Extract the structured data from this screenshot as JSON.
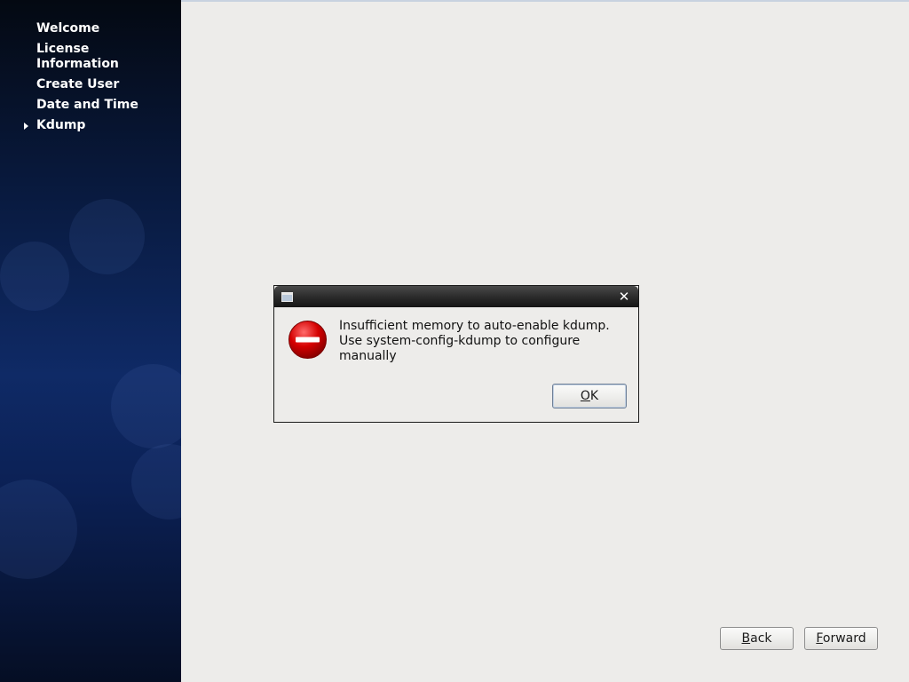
{
  "sidebar": {
    "items": [
      {
        "label": "Welcome",
        "current": false
      },
      {
        "label": "License Information",
        "current": false
      },
      {
        "label": "Create User",
        "current": false
      },
      {
        "label": "Date and Time",
        "current": false
      },
      {
        "label": "Kdump",
        "current": true
      }
    ]
  },
  "dialog": {
    "title": "",
    "message_line1": "Insufficient memory to auto-enable kdump.",
    "message_line2": "Use system-config-kdump to configure manually",
    "ok_mnemonic": "O",
    "ok_rest": "K",
    "icon": "error-icon"
  },
  "footer": {
    "back_mnemonic": "B",
    "back_rest": "ack",
    "forward_mnemonic": "F",
    "forward_rest": "orward"
  },
  "colors": {
    "sidebar_top": "#040912",
    "sidebar_mid": "#0f2a66",
    "content_bg": "#edecea",
    "error_red": "#cc0000"
  }
}
